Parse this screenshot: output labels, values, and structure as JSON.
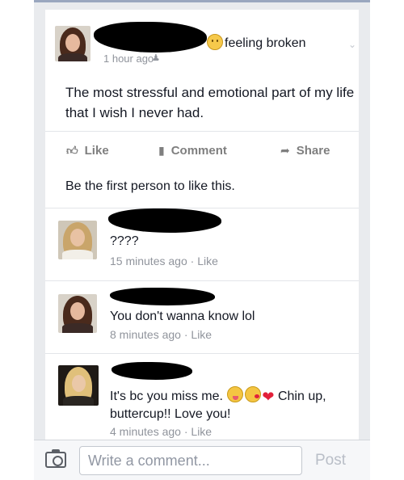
{
  "post": {
    "feeling": "feeling broken",
    "timestamp": "1 hour ago ·",
    "audience_icon": "friends-icon",
    "text": "The most stressful and emotional part of my life that I wish I never had."
  },
  "actions": {
    "like": "Like",
    "comment": "Comment",
    "share": "Share"
  },
  "like_summary": "Be the first person to like this.",
  "comments": [
    {
      "text": "????",
      "time": "15 minutes ago",
      "sep": " · ",
      "like": "Like"
    },
    {
      "text": "You don't wanna know lol",
      "time": "8 minutes ago",
      "sep": " · ",
      "like": "Like"
    },
    {
      "text_before": "It's bc you miss me. ",
      "text_after": " Chin up, buttercup!! Love you!",
      "time": "4 minutes ago",
      "sep": " · ",
      "like": "Like"
    }
  ],
  "composer": {
    "placeholder": "Write a comment...",
    "post_label": "Post"
  },
  "colors": {
    "background": "#e9ebee",
    "meta_gray": "#90949c",
    "heart": "#e2203a"
  }
}
